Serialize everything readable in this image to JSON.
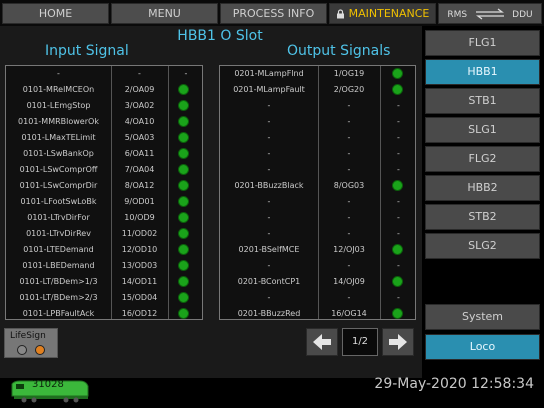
{
  "topbar": {
    "home": "HOME",
    "menu": "MENU",
    "process_info": "PROCESS INFO",
    "maintenance": "MAINTENANCE",
    "rms": "RMS",
    "ddu": "DDU"
  },
  "slot_title": "HBB1 O Slot",
  "input_title": "Input Signal",
  "output_title": "Output Signals",
  "input_rows": [
    {
      "name": "-",
      "code": "-",
      "status": "-"
    },
    {
      "name": "0101-MRelMCEOn",
      "code": "2/OA09",
      "status": "on"
    },
    {
      "name": "0101-LEmgStop",
      "code": "3/OA02",
      "status": "on"
    },
    {
      "name": "0101-MMRBlowerOk",
      "code": "4/OA10",
      "status": "on"
    },
    {
      "name": "0101-LMaxTELimit",
      "code": "5/OA03",
      "status": "on"
    },
    {
      "name": "0101-LSwBankOp",
      "code": "6/OA11",
      "status": "on"
    },
    {
      "name": "0101-LSwComprOff",
      "code": "7/OA04",
      "status": "on"
    },
    {
      "name": "0101-LSwComprDir",
      "code": "8/OA12",
      "status": "on"
    },
    {
      "name": "0101-LFootSwLoBk",
      "code": "9/OD01",
      "status": "on"
    },
    {
      "name": "0101-LTrvDirFor",
      "code": "10/OD9",
      "status": "on"
    },
    {
      "name": "0101-LTrvDirRev",
      "code": "11/OD02",
      "status": "on"
    },
    {
      "name": "0101-LTEDemand",
      "code": "12/OD10",
      "status": "on"
    },
    {
      "name": "0101-LBEDemand",
      "code": "13/OD03",
      "status": "on"
    },
    {
      "name": "0101-LT/BDem>1/3",
      "code": "14/OD11",
      "status": "on"
    },
    {
      "name": "0101-LT/BDem>2/3",
      "code": "15/OD04",
      "status": "on"
    },
    {
      "name": "0101-LPBFaultAck",
      "code": "16/OD12",
      "status": "on"
    }
  ],
  "output_rows": [
    {
      "name": "0201-MLampFlnd",
      "code": "1/OG19",
      "status": "on"
    },
    {
      "name": "0201-MLampFault",
      "code": "2/OG20",
      "status": "on"
    },
    {
      "name": "-",
      "code": "-",
      "status": "-"
    },
    {
      "name": "-",
      "code": "-",
      "status": "-"
    },
    {
      "name": "-",
      "code": "-",
      "status": "-"
    },
    {
      "name": "-",
      "code": "-",
      "status": "-"
    },
    {
      "name": "-",
      "code": "-",
      "status": "-"
    },
    {
      "name": "0201-BBuzzBlack",
      "code": "8/OG03",
      "status": "on"
    },
    {
      "name": "-",
      "code": "-",
      "status": "-"
    },
    {
      "name": "-",
      "code": "-",
      "status": "-"
    },
    {
      "name": "-",
      "code": "-",
      "status": "-"
    },
    {
      "name": "0201-BSelfMCE",
      "code": "12/OJ03",
      "status": "on"
    },
    {
      "name": "-",
      "code": "-",
      "status": "-"
    },
    {
      "name": "0201-BContCP1",
      "code": "14/OJ09",
      "status": "on"
    },
    {
      "name": "-",
      "code": "-",
      "status": "-"
    },
    {
      "name": "0201-BBuzzRed",
      "code": "16/OG14",
      "status": "on"
    }
  ],
  "side_buttons": [
    "FLG1",
    "HBB1",
    "STB1",
    "SLG1",
    "FLG2",
    "HBB2",
    "STB2",
    "SLG2"
  ],
  "side_active": "HBB1",
  "system_label": "System",
  "loco_label": "Loco",
  "page_indicator": "1/2",
  "lifesign_label": "LifeSign",
  "loco_number": "31028",
  "datetime": "29-May-2020 12:58:34",
  "colors": {
    "accent_blue": "#4fc3e8",
    "status_green": "#1aa31a",
    "maintenance_yellow": "#f0c000",
    "active_button": "#2a8fb0"
  }
}
